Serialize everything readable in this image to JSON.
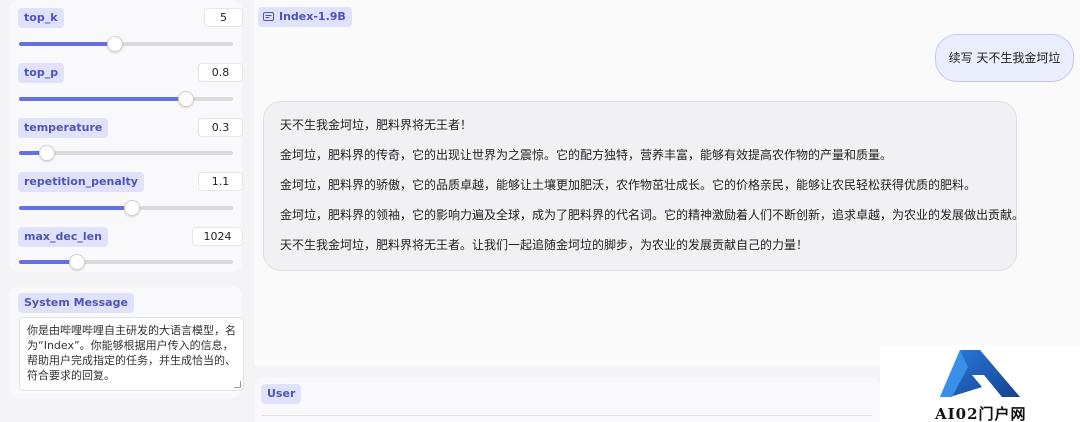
{
  "params": [
    {
      "label": "top_k",
      "value": "5",
      "level": 0.45
    },
    {
      "label": "top_p",
      "value": "0.8",
      "level": 0.78
    },
    {
      "label": "temperature",
      "value": "0.3",
      "level": 0.13
    },
    {
      "label": "repetition_penalty",
      "value": "1.1",
      "level": 0.53
    },
    {
      "label": "max_dec_len",
      "value": "1024",
      "level": 0.27
    }
  ],
  "system": {
    "label": "System Message",
    "text": "你是由哔哩哔哩自主研发的大语言模型，名为“Index”。你能够根据用户传入的信息，帮助用户完成指定的任务，并生成恰当的、符合要求的回复。"
  },
  "chat": {
    "label": "Index-1.9B",
    "user_message": "续写 天不生我金坷垃",
    "bot_paragraphs": [
      "天不生我金坷垃，肥料界将无王者！",
      "金坷垃，肥料界的传奇，它的出现让世界为之震惊。它的配方独特，营养丰富，能够有效提高农作物的产量和质量。",
      "金坷垃，肥料界的骄傲，它的品质卓越，能够让土壤更加肥沃，农作物茁壮成长。它的价格亲民，能够让农民轻松获得优质的肥料。",
      "金坷垃，肥料界的领袖，它的影响力遍及全球，成为了肥料界的代名词。它的精神激励着人们不断创新，追求卓越，为农业的发展做出贡献。",
      "天不生我金坷垃，肥料界将无王者。让我们一起追随金坷垃的脚步，为农业的发展贡献自己的力量！"
    ]
  },
  "input": {
    "label": "User"
  },
  "watermark": {
    "text": "AI02门户网"
  },
  "colors": {
    "accent": "#6470e6",
    "tag_bg": "#dfe2fa",
    "tag_text": "#4d55b8",
    "user_bubble": "#eaedfb"
  }
}
